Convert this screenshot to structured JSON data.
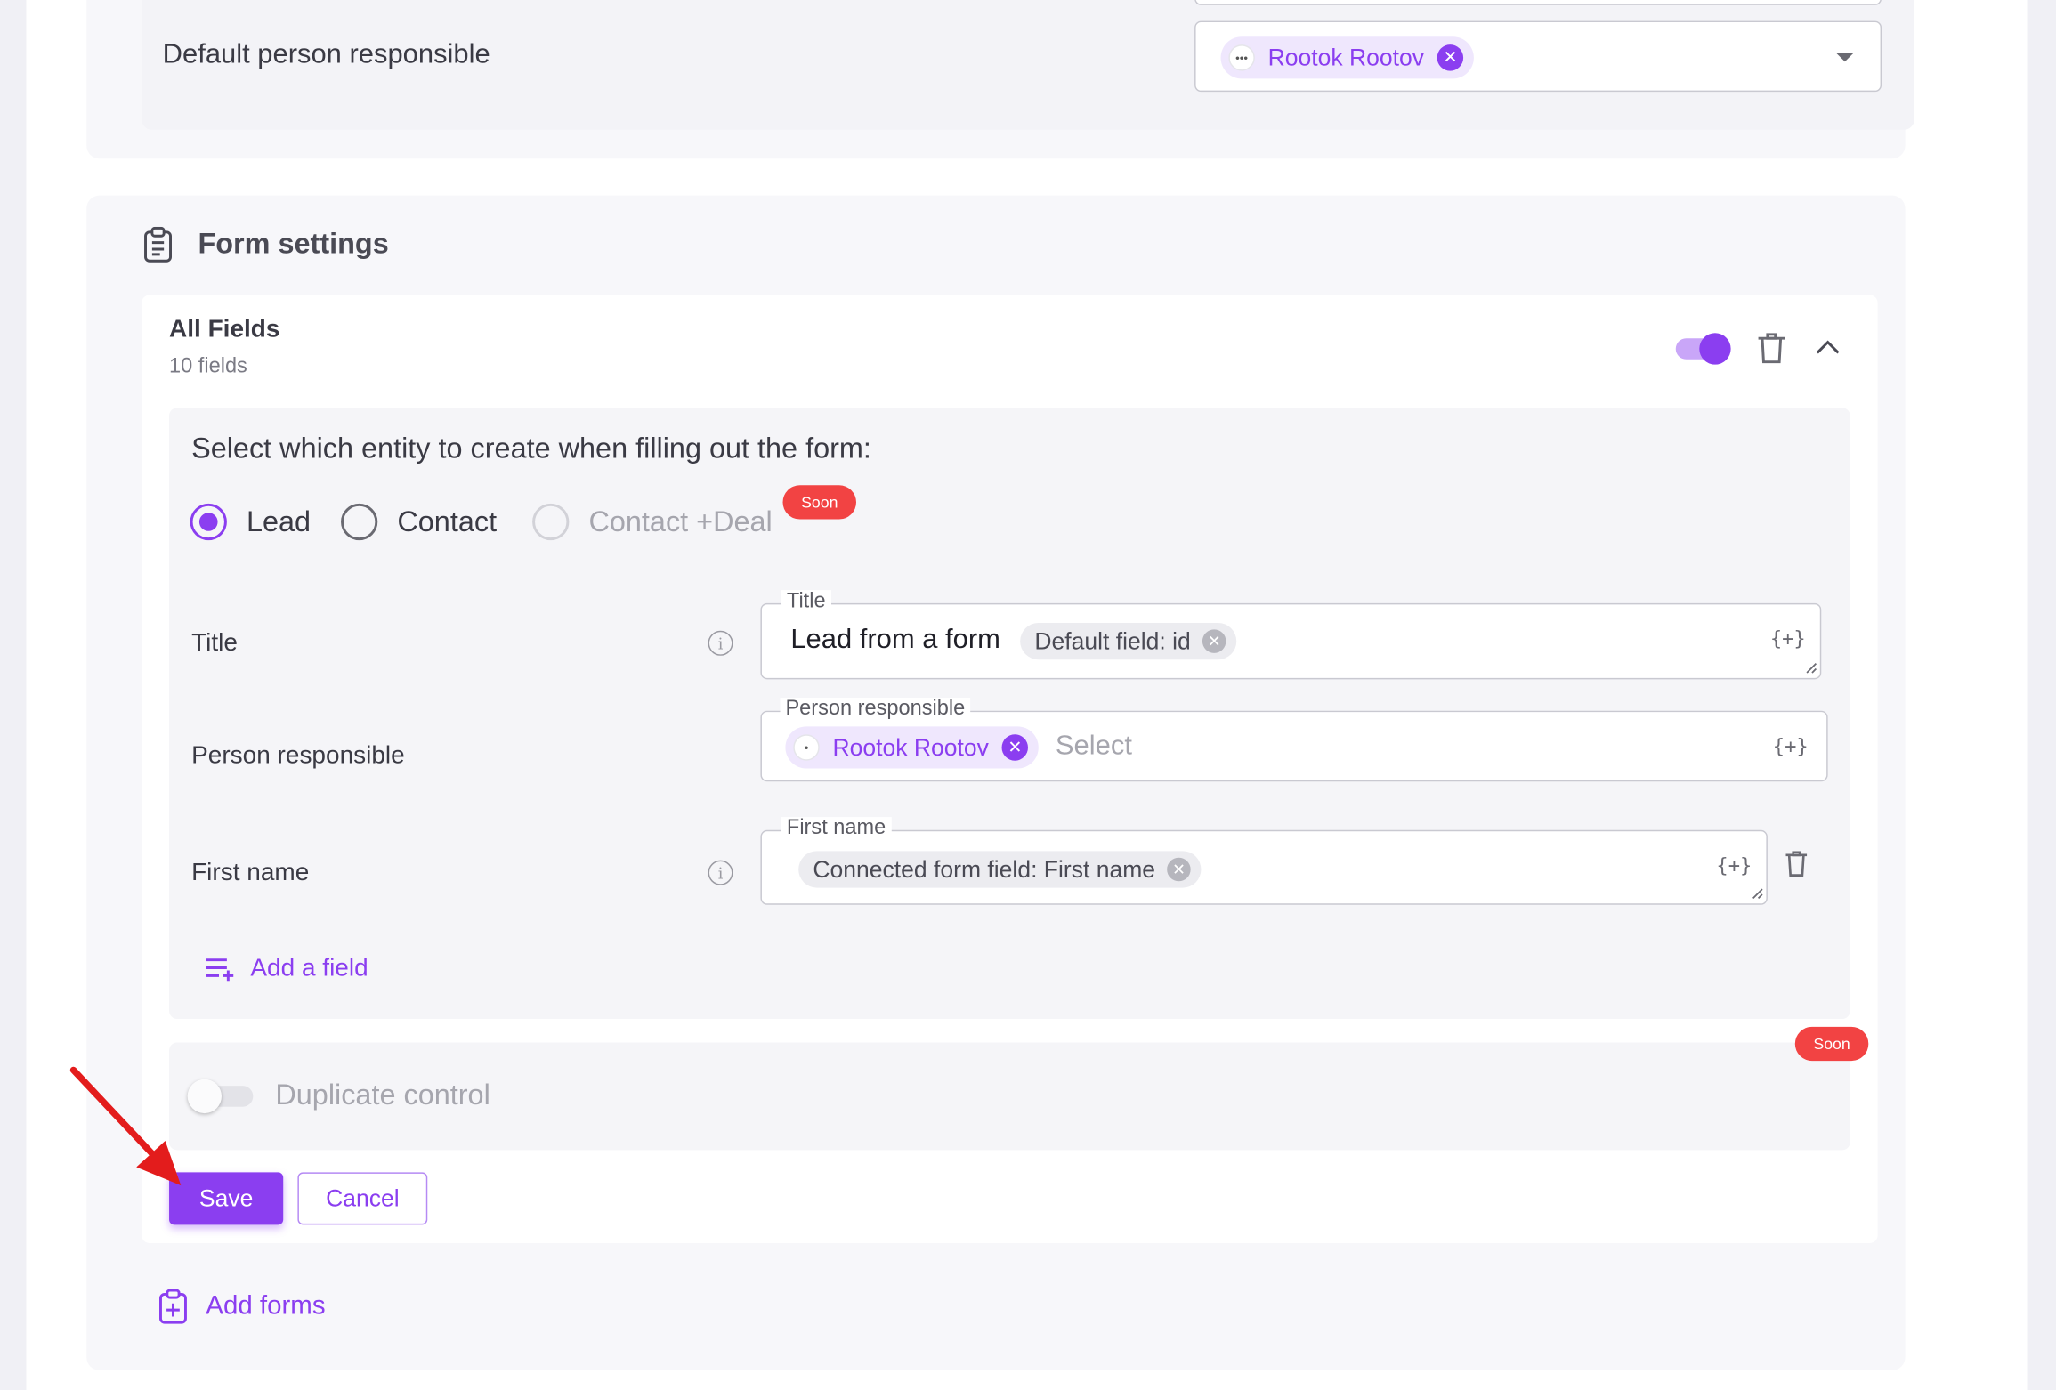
{
  "default_person": {
    "label": "Default person responsible",
    "selected": {
      "name": "Rootok Rootov",
      "avatar_text": "•••"
    }
  },
  "form_settings": {
    "title": "Form settings",
    "group": {
      "name": "All Fields",
      "count": "10 fields",
      "enabled": true
    },
    "entity_prompt": "Select which entity to create when filling out the form:",
    "entity_options": [
      {
        "label": "Lead",
        "checked": true,
        "disabled": false
      },
      {
        "label": "Contact",
        "checked": false,
        "disabled": false
      },
      {
        "label": "Contact +Deal",
        "checked": false,
        "disabled": true,
        "badge": "Soon"
      }
    ],
    "rows": {
      "title": {
        "label": "Title",
        "legend": "Title",
        "text": "Lead from a form",
        "chip": "Default field: id",
        "braces": "{+}"
      },
      "person": {
        "label": "Person responsible",
        "legend": "Person responsible",
        "chip": "Rootok Rootov",
        "avatar_text": "•",
        "placeholder": "Select",
        "braces": "{+}"
      },
      "first_name": {
        "label": "First name",
        "legend": "First name",
        "chip": "Connected form field: First name",
        "braces": "{+}"
      }
    },
    "add_field": "Add a field",
    "duplicate": {
      "label": "Duplicate control",
      "badge": "Soon",
      "enabled": false
    },
    "save": "Save",
    "cancel": "Cancel",
    "add_forms": "Add forms"
  },
  "colors": {
    "accent": "#8b3ef0",
    "soon": "#f24343"
  },
  "icons": [
    "clipboard-icon",
    "trash-icon",
    "chevron-up-icon",
    "info-icon",
    "add-list-icon",
    "clipboard-plus-icon",
    "close-icon",
    "caret-down-icon",
    "arrow-pointer"
  ]
}
